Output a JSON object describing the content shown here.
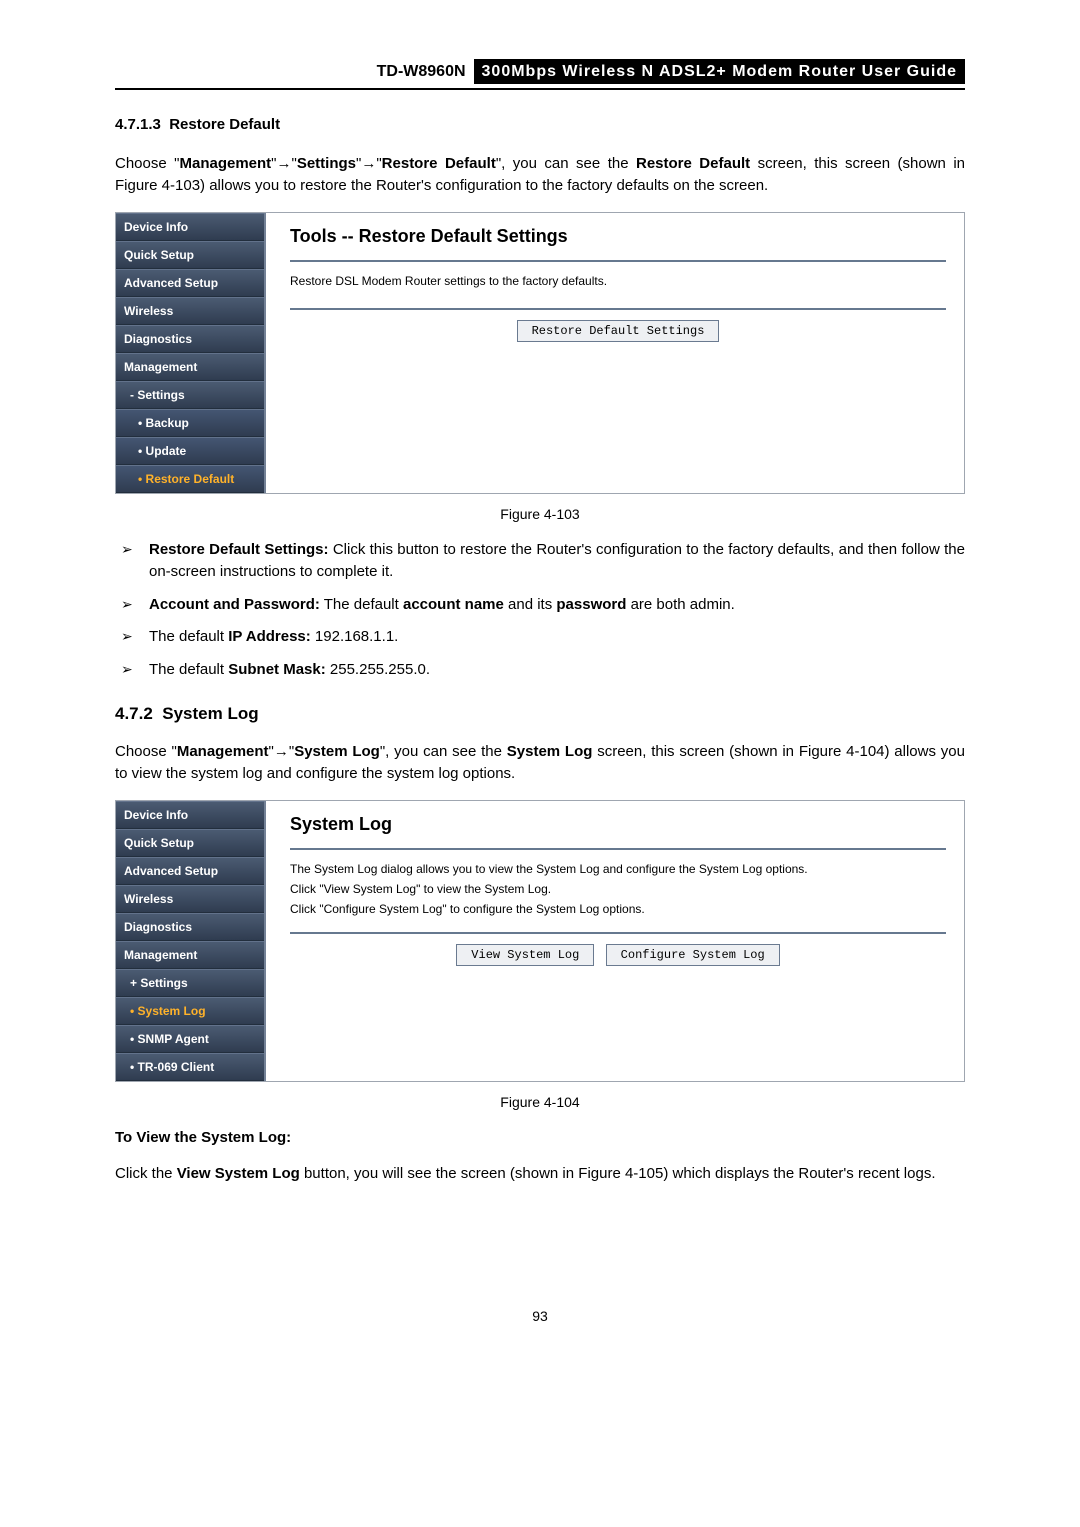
{
  "header": {
    "model": "TD-W8960N",
    "title": "300Mbps Wireless N ADSL2+ Modem Router User Guide"
  },
  "sec1": {
    "num": "4.7.1.3",
    "title": "Restore Default",
    "para_parts": {
      "a": "Choose \"",
      "b": "Management",
      "c": "\"",
      "d": "\"",
      "e": "Settings",
      "f": "\"",
      "g": "\"",
      "h": "Restore Default",
      "i": "\", you can see the ",
      "j": "Restore Default",
      "k": " screen, this screen (shown in Figure 4-103) allows you to restore the Router's configuration to the factory defaults on the screen."
    }
  },
  "fig1": {
    "nav": {
      "i0": "Device Info",
      "i1": "Quick Setup",
      "i2": "Advanced Setup",
      "i3": "Wireless",
      "i4": "Diagnostics",
      "i5": "Management",
      "s0": "- Settings",
      "ss0": "• Backup",
      "ss1": "• Update",
      "ss2": "• Restore Default"
    },
    "panel": {
      "title": "Tools -- Restore Default Settings",
      "text": "Restore DSL Modem Router settings to the factory defaults.",
      "btn": "Restore Default Settings"
    },
    "caption": "Figure 4-103"
  },
  "bullets1": {
    "b0a": "Restore Default Settings:",
    "b0b": " Click this button to restore the Router's configuration to the factory defaults, and then follow the on-screen instructions to complete it.",
    "b1a": "Account and Password:",
    "b1b": " The default ",
    "b1c": "account name",
    "b1d": " and its ",
    "b1e": "password",
    "b1f": " are both admin.",
    "b2a": "The default ",
    "b2b": "IP Address:",
    "b2c": " 192.168.1.1.",
    "b3a": "The default ",
    "b3b": "Subnet Mask:",
    "b3c": " 255.255.255.0."
  },
  "sec2": {
    "num": "4.7.2",
    "title": "System Log",
    "para_parts": {
      "a": "Choose \"",
      "b": "Management",
      "c": "\"",
      "d": "\"",
      "e": "System Log",
      "f": "\", you can see the ",
      "g": "System Log",
      "h": " screen, this screen (shown in Figure 4-104) allows you to view the system log and configure the system log options."
    }
  },
  "fig2": {
    "nav": {
      "i0": "Device Info",
      "i1": "Quick Setup",
      "i2": "Advanced Setup",
      "i3": "Wireless",
      "i4": "Diagnostics",
      "i5": "Management",
      "s0": "+ Settings",
      "s1": "• System Log",
      "s2": "• SNMP Agent",
      "s3": "• TR-069 Client"
    },
    "panel": {
      "title": "System Log",
      "t0": "The System Log dialog allows you to view the System Log and configure the System Log options.",
      "t1": "Click \"View System Log\" to view the System Log.",
      "t2": "Click \"Configure System Log\" to configure the System Log options.",
      "btn0": "View System Log",
      "btn1": "Configure System Log"
    },
    "caption": "Figure 4-104"
  },
  "tail": {
    "h": "To View the System Log:",
    "p_a": "Click the ",
    "p_b": "View System Log",
    "p_c": " button, you will see the screen (shown in Figure 4-105) which displays the Router's recent logs."
  },
  "page": "93"
}
